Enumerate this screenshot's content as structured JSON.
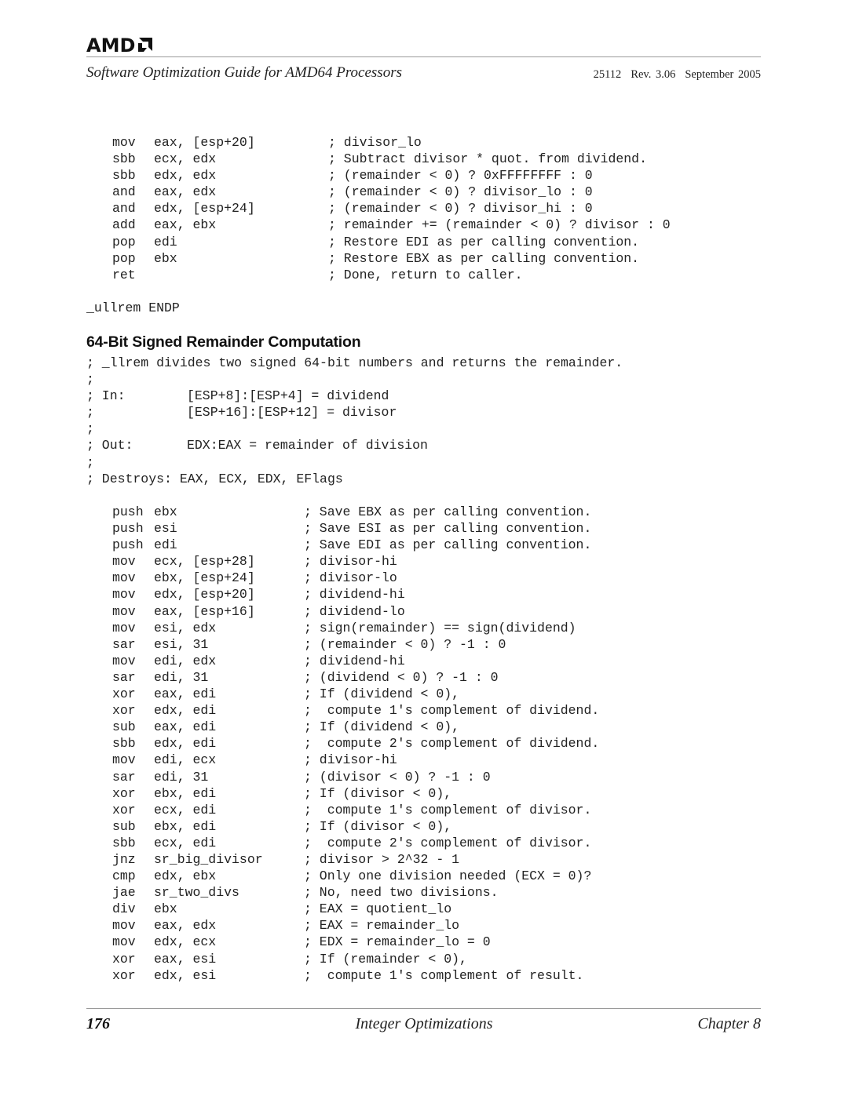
{
  "header": {
    "brand": "AMD",
    "brand_icon": "amd-arrow-logo-icon",
    "doc_title": "Software Optimization Guide for AMD64 Processors",
    "doc_number": "25112",
    "revision": "Rev. 3.06",
    "date": "September 2005"
  },
  "section1": {
    "lines": [
      {
        "mnemonic": "mov",
        "operands": "eax, [esp+20]",
        "comment": "; divisor_lo"
      },
      {
        "mnemonic": "sbb",
        "operands": "ecx, edx",
        "comment": "; Subtract divisor * quot. from dividend."
      },
      {
        "mnemonic": "sbb",
        "operands": "edx, edx",
        "comment": "; (remainder < 0) ? 0xFFFFFFFF : 0"
      },
      {
        "mnemonic": "and",
        "operands": "eax, edx",
        "comment": "; (remainder < 0) ? divisor_lo : 0"
      },
      {
        "mnemonic": "and",
        "operands": "edx, [esp+24]",
        "comment": "; (remainder < 0) ? divisor_hi : 0"
      },
      {
        "mnemonic": "add",
        "operands": "eax, ebx",
        "comment": "; remainder += (remainder < 0) ? divisor : 0"
      },
      {
        "mnemonic": "pop",
        "operands": "edi",
        "comment": "; Restore EDI as per calling convention."
      },
      {
        "mnemonic": "pop",
        "operands": "ebx",
        "comment": "; Restore EBX as per calling convention."
      },
      {
        "mnemonic": "ret",
        "operands": "",
        "comment": "; Done, return to caller."
      }
    ],
    "endp": "_ullrem ENDP"
  },
  "section2": {
    "heading": "64-Bit Signed Remainder Computation",
    "header_comments": [
      {
        "label": "; _llrem divides two signed 64-bit numbers and returns the remainder.",
        "value": ""
      },
      {
        "label": ";",
        "value": ""
      },
      {
        "label": "; In:",
        "value": "[ESP+8]:[ESP+4] = dividend"
      },
      {
        "label": ";",
        "value": "[ESP+16]:[ESP+12] = divisor"
      },
      {
        "label": ";",
        "value": ""
      },
      {
        "label": "; Out:",
        "value": "EDX:EAX = remainder of division"
      },
      {
        "label": ";",
        "value": ""
      },
      {
        "label": "; Destroys: EAX, ECX, EDX, EFlags",
        "value": ""
      }
    ],
    "lines": [
      {
        "mnemonic": "push",
        "operands": "ebx",
        "comment": "; Save EBX as per calling convention."
      },
      {
        "mnemonic": "push",
        "operands": "esi",
        "comment": "; Save ESI as per calling convention."
      },
      {
        "mnemonic": "push",
        "operands": "edi",
        "comment": "; Save EDI as per calling convention."
      },
      {
        "mnemonic": "mov",
        "operands": "ecx, [esp+28]",
        "comment": "; divisor-hi"
      },
      {
        "mnemonic": "mov",
        "operands": "ebx, [esp+24]",
        "comment": "; divisor-lo"
      },
      {
        "mnemonic": "mov",
        "operands": "edx, [esp+20]",
        "comment": "; dividend-hi"
      },
      {
        "mnemonic": "mov",
        "operands": "eax, [esp+16]",
        "comment": "; dividend-lo"
      },
      {
        "mnemonic": "mov",
        "operands": "esi, edx",
        "comment": "; sign(remainder) == sign(dividend)"
      },
      {
        "mnemonic": "sar",
        "operands": "esi, 31",
        "comment": "; (remainder < 0) ? -1 : 0"
      },
      {
        "mnemonic": "mov",
        "operands": "edi, edx",
        "comment": "; dividend-hi"
      },
      {
        "mnemonic": "sar",
        "operands": "edi, 31",
        "comment": "; (dividend < 0) ? -1 : 0"
      },
      {
        "mnemonic": "xor",
        "operands": "eax, edi",
        "comment": "; If (dividend < 0),"
      },
      {
        "mnemonic": "xor",
        "operands": "edx, edi",
        "comment": ";  compute 1's complement of dividend."
      },
      {
        "mnemonic": "sub",
        "operands": "eax, edi",
        "comment": "; If (dividend < 0),"
      },
      {
        "mnemonic": "sbb",
        "operands": "edx, edi",
        "comment": ";  compute 2's complement of dividend."
      },
      {
        "mnemonic": "mov",
        "operands": "edi, ecx",
        "comment": "; divisor-hi"
      },
      {
        "mnemonic": "sar",
        "operands": "edi, 31",
        "comment": "; (divisor < 0) ? -1 : 0"
      },
      {
        "mnemonic": "xor",
        "operands": "ebx, edi",
        "comment": "; If (divisor < 0),"
      },
      {
        "mnemonic": "xor",
        "operands": "ecx, edi",
        "comment": ";  compute 1's complement of divisor."
      },
      {
        "mnemonic": "sub",
        "operands": "ebx, edi",
        "comment": "; If (divisor < 0),"
      },
      {
        "mnemonic": "sbb",
        "operands": "ecx, edi",
        "comment": ";  compute 2's complement of divisor."
      },
      {
        "mnemonic": "jnz",
        "operands": "sr_big_divisor",
        "comment": "; divisor > 2^32 - 1"
      },
      {
        "mnemonic": "cmp",
        "operands": "edx, ebx",
        "comment": "; Only one division needed (ECX = 0)?"
      },
      {
        "mnemonic": "jae",
        "operands": "sr_two_divs",
        "comment": "; No, need two divisions."
      },
      {
        "mnemonic": "div",
        "operands": "ebx",
        "comment": "; EAX = quotient_lo"
      },
      {
        "mnemonic": "mov",
        "operands": "eax, edx",
        "comment": "; EAX = remainder_lo"
      },
      {
        "mnemonic": "mov",
        "operands": "edx, ecx",
        "comment": "; EDX = remainder_lo = 0"
      },
      {
        "mnemonic": "xor",
        "operands": "eax, esi",
        "comment": "; If (remainder < 0),"
      },
      {
        "mnemonic": "xor",
        "operands": "edx, esi",
        "comment": ";  compute 1's complement of result."
      }
    ]
  },
  "footer": {
    "page_number": "176",
    "chapter_title": "Integer Optimizations",
    "chapter": "Chapter 8"
  }
}
